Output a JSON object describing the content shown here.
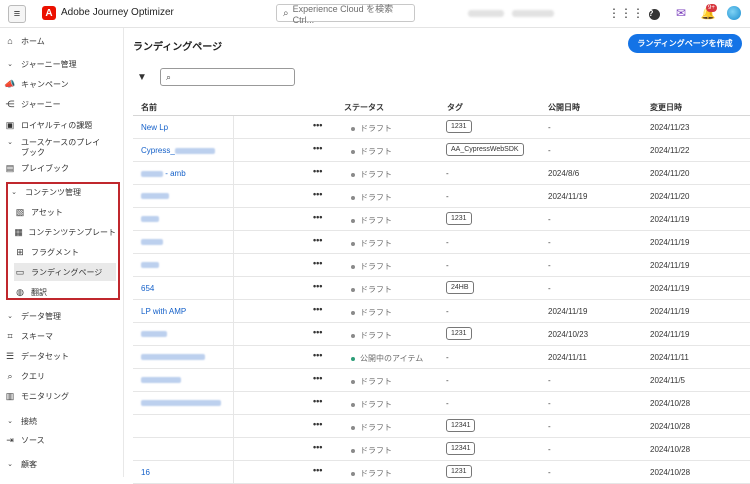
{
  "topbar": {
    "menu_icon": "hamburger-icon",
    "logo_letter": "A",
    "app_title": "Adobe Journey Optimizer",
    "search_placeholder": "Experience Cloud を検索 Ctrl...",
    "notification_count": "9+"
  },
  "sidebar": {
    "items": [
      {
        "type": "item",
        "label": "ホーム",
        "icon": "home-icon"
      },
      {
        "type": "group",
        "label": "ジャーニー管理"
      },
      {
        "type": "item",
        "label": "キャンペーン",
        "icon": "megaphone-icon"
      },
      {
        "type": "item",
        "label": "ジャーニー",
        "icon": "journey-icon"
      },
      {
        "type": "item",
        "label": "ロイヤルティの課題",
        "icon": "challenge-icon"
      },
      {
        "type": "group",
        "label": "ユースケースのプレイ\nブック"
      },
      {
        "type": "item",
        "label": "プレイブック",
        "icon": "playbook-icon"
      },
      {
        "type": "group",
        "label": "コンテンツ管理"
      },
      {
        "type": "item",
        "label": "アセット",
        "icon": "assets-icon"
      },
      {
        "type": "item",
        "label": "コンテンツテンプレート",
        "icon": "template-icon"
      },
      {
        "type": "item",
        "label": "フラグメント",
        "icon": "fragment-icon"
      },
      {
        "type": "item",
        "label": "ランディングページ",
        "icon": "landing-page-icon",
        "active": true
      },
      {
        "type": "item",
        "label": "翻訳",
        "icon": "globe-icon"
      },
      {
        "type": "group",
        "label": "データ管理"
      },
      {
        "type": "item",
        "label": "スキーマ",
        "icon": "schema-icon"
      },
      {
        "type": "item",
        "label": "データセット",
        "icon": "dataset-icon"
      },
      {
        "type": "item",
        "label": "クエリ",
        "icon": "query-icon"
      },
      {
        "type": "item",
        "label": "モニタリング",
        "icon": "monitoring-icon"
      },
      {
        "type": "group",
        "label": "接続"
      },
      {
        "type": "item",
        "label": "ソース",
        "icon": "source-icon"
      },
      {
        "type": "group",
        "label": "顧客"
      }
    ]
  },
  "main": {
    "page_title": "ランディングページ",
    "create_button": "ランディングページを作成",
    "columns": {
      "name": "名前",
      "status": "ステータス",
      "tag": "タグ",
      "published": "公開日時",
      "modified": "変更日時"
    },
    "rows": [
      {
        "name": "New Lp",
        "status": "ドラフト",
        "tag": "1231",
        "published": "-",
        "modified": "2024/11/23"
      },
      {
        "name": "Cypress_",
        "status": "ドラフト",
        "tag": "AA_CypressWebSDK",
        "published": "-",
        "modified": "2024/11/22"
      },
      {
        "name": " - amb",
        "status": "ドラフト",
        "tag": "-",
        "published": "2024/8/6",
        "modified": "2024/11/20"
      },
      {
        "name": "",
        "status": "ドラフト",
        "tag": "-",
        "published": "2024/11/19",
        "modified": "2024/11/20"
      },
      {
        "name": "",
        "status": "ドラフト",
        "tag": "1231",
        "published": "-",
        "modified": "2024/11/19"
      },
      {
        "name": "",
        "status": "ドラフト",
        "tag": "-",
        "published": "-",
        "modified": "2024/11/19"
      },
      {
        "name": "",
        "status": "ドラフト",
        "tag": "-",
        "published": "-",
        "modified": "2024/11/19"
      },
      {
        "name": "654",
        "status": "ドラフト",
        "tag": "24HB",
        "published": "-",
        "modified": "2024/11/19"
      },
      {
        "name": "LP with AMP",
        "status": "ドラフト",
        "tag": "-",
        "published": "2024/11/19",
        "modified": "2024/11/19"
      },
      {
        "name": "",
        "status": "ドラフト",
        "tag": "1231",
        "published": "2024/10/23",
        "modified": "2024/11/19"
      },
      {
        "name": "",
        "status": "公開中のアイテム",
        "tag": "-",
        "published": "2024/11/11",
        "modified": "2024/11/11"
      },
      {
        "name": "",
        "status": "ドラフト",
        "tag": "-",
        "published": "-",
        "modified": "2024/11/5"
      },
      {
        "name": "",
        "status": "ドラフト",
        "tag": "-",
        "published": "-",
        "modified": "2024/10/28"
      },
      {
        "name": "",
        "status": "ドラフト",
        "tag": "12341",
        "published": "-",
        "modified": "2024/10/28"
      },
      {
        "name": "",
        "status": "ドラフト",
        "tag": "12341",
        "published": "-",
        "modified": "2024/10/28"
      },
      {
        "name": "16",
        "status": "ドラフト",
        "tag": "1231",
        "published": "-",
        "modified": "2024/10/28"
      }
    ],
    "row_action": "•••"
  }
}
